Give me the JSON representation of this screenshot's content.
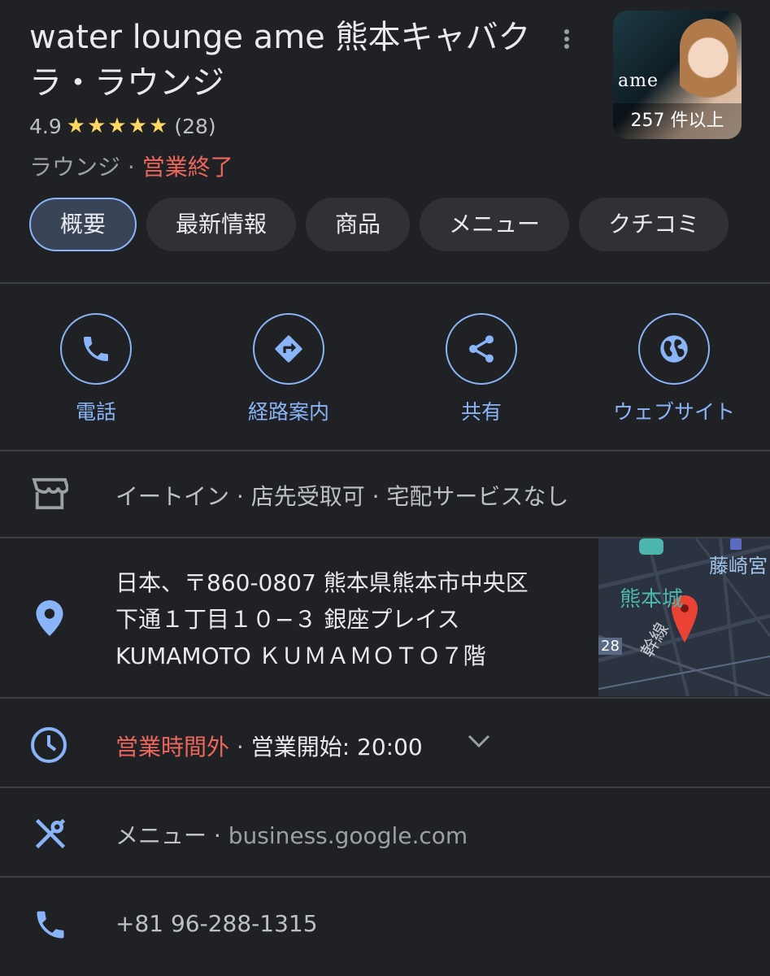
{
  "header": {
    "title": "water lounge ame 熊本キャバクラ・ラウンジ",
    "rating": "4.9",
    "stars": "★★★★★",
    "review_count": "(28)",
    "category": "ラウンジ",
    "category_sep": " · ",
    "status": "営業終了",
    "photo_count": "257 件以上",
    "thumb_logo": "ame"
  },
  "tabs": [
    {
      "label": "概要",
      "active": true
    },
    {
      "label": "最新情報"
    },
    {
      "label": "商品"
    },
    {
      "label": "メニュー"
    },
    {
      "label": "クチコミ"
    }
  ],
  "actions": [
    {
      "label": "電話",
      "icon": "phone-icon"
    },
    {
      "label": "経路案内",
      "icon": "directions-icon"
    },
    {
      "label": "共有",
      "icon": "share-icon"
    },
    {
      "label": "ウェブサイト",
      "icon": "globe-icon"
    }
  ],
  "services": {
    "text": "イートイン · 店先受取可 · 宅配サービスなし",
    "icon": "store-icon"
  },
  "address": {
    "lines": [
      "日本、〒860-0807 熊本県熊本市中央区",
      "下通１丁目１０−３ 銀座プレイス",
      "KUMAMOTO ＫＵＭＡＭＯＴＯ７階"
    ],
    "icon": "location-pin-icon",
    "map_labels": [
      "藤崎宮",
      "熊本城",
      "幹線",
      "28"
    ]
  },
  "hours": {
    "status": "営業時間外",
    "sep": " · ",
    "opens": "営業開始: 20:00",
    "icon": "clock-icon"
  },
  "menu_link": {
    "label": "メニュー",
    "sep": " · ",
    "url": "business.google.com",
    "icon": "restaurant-icon"
  },
  "phone": {
    "number": "+81 96-288-1315",
    "icon": "phone-icon"
  },
  "colors": {
    "accent": "#8ab4f8",
    "closed": "#ee675c",
    "background": "#202124",
    "star": "#fdd663"
  }
}
